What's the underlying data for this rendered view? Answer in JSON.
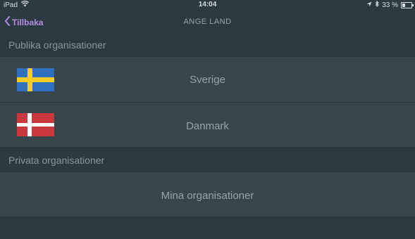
{
  "status_bar": {
    "device": "iPad",
    "time": "14:04",
    "battery": "33 %",
    "battery_level": 0.33
  },
  "nav": {
    "back_label": "Tillbaka",
    "title": "ANGE LAND"
  },
  "sections": {
    "public_header": "Publika organisationer",
    "private_header": "Privata organisationer"
  },
  "countries": [
    {
      "label": "Sverige",
      "flag": "sweden-flag",
      "colors": {
        "field": "#2f6fc0",
        "cross": "#f5cd22"
      }
    },
    {
      "label": "Danmark",
      "flag": "denmark-flag",
      "colors": {
        "field": "#c8383d",
        "cross": "#ffffff"
      }
    }
  ],
  "private_items": [
    {
      "label": "Mina organisationer"
    }
  ],
  "colors": {
    "accent": "#b48ee0",
    "background": "#2b3a40",
    "row": "#36464b"
  }
}
